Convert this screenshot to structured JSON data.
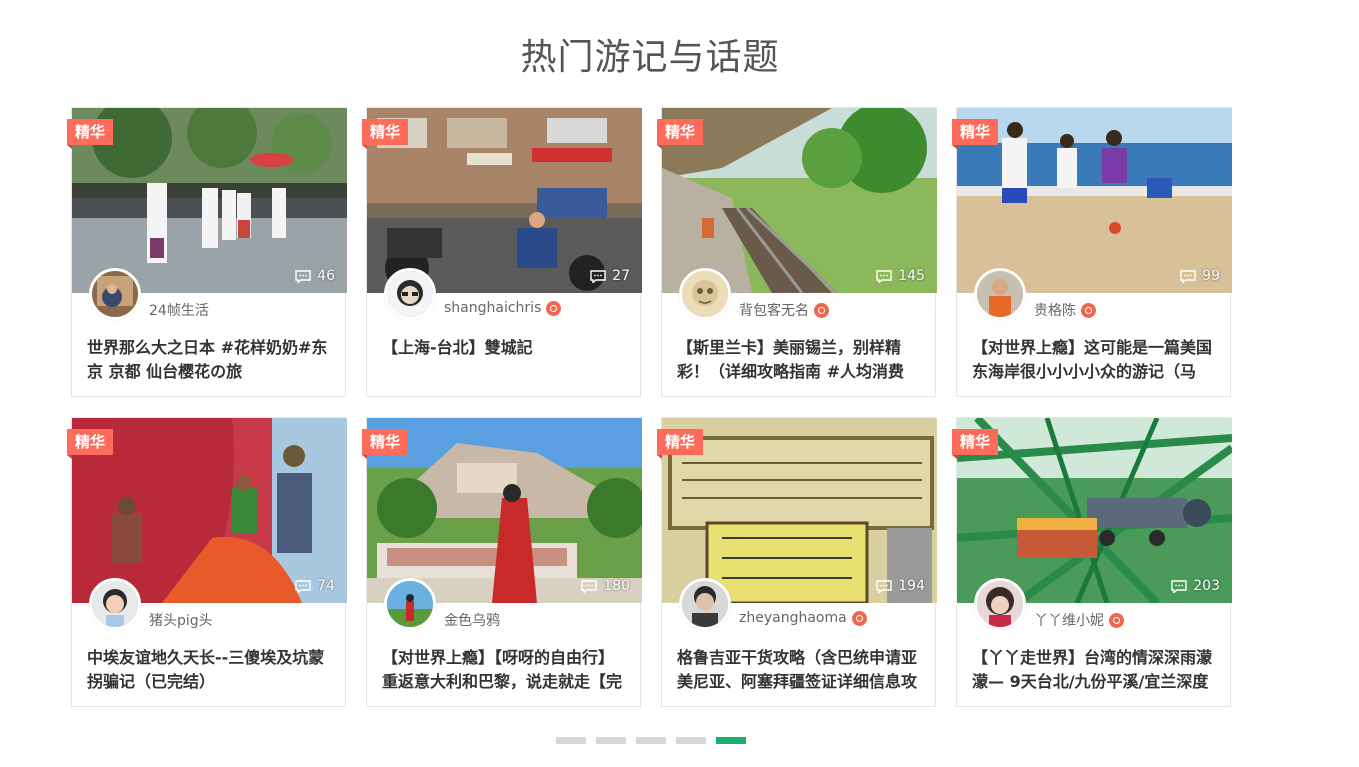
{
  "section": {
    "title": "热门游记与话题"
  },
  "badge_label": "精华",
  "cards": [
    {
      "author": "24帧生活",
      "verified": false,
      "comments": "46",
      "title": "世界那么大之日本 #花样奶奶#东京 京都 仙台樱花の旅"
    },
    {
      "author": "shanghaichris",
      "verified": true,
      "comments": "27",
      "title": "【上海-台北】雙城記"
    },
    {
      "author": "背包客无名",
      "verified": true,
      "comments": "145",
      "title": "【斯里兰卡】美丽锡兰，别样精彩！（详细攻略指南 #人均消费"
    },
    {
      "author": "贵格陈",
      "verified": true,
      "comments": "99",
      "title": "【对世界上瘾】这可能是一篇美国东海岸很小小小小众的游记（马"
    },
    {
      "author": "猪头pig头",
      "verified": false,
      "comments": "74",
      "title": "中埃友谊地久天长--三傻埃及坑蒙拐骗记（已完结）"
    },
    {
      "author": "金色乌鸦",
      "verified": false,
      "comments": "180",
      "title": "【对世界上瘾】【呀呀的自由行】重返意大利和巴黎，说走就走【完"
    },
    {
      "author": "zheyanghaoma",
      "verified": true,
      "comments": "194",
      "title": "格鲁吉亚干货攻略（含巴统申请亚美尼亚、阿塞拜疆签证详细信息攻"
    },
    {
      "author": "丫丫维小妮",
      "verified": true,
      "comments": "203",
      "title": "【丫丫走世界】台湾的情深深雨濛濛— 9天台北/九份平溪/宜兰深度"
    }
  ],
  "pager": {
    "count": 5,
    "active": 5
  },
  "colors": {
    "badge": "#ff6b5a",
    "pager_active": "#1ab16e",
    "pager_idle": "#d8d8d8",
    "verified": "#f0674f"
  }
}
